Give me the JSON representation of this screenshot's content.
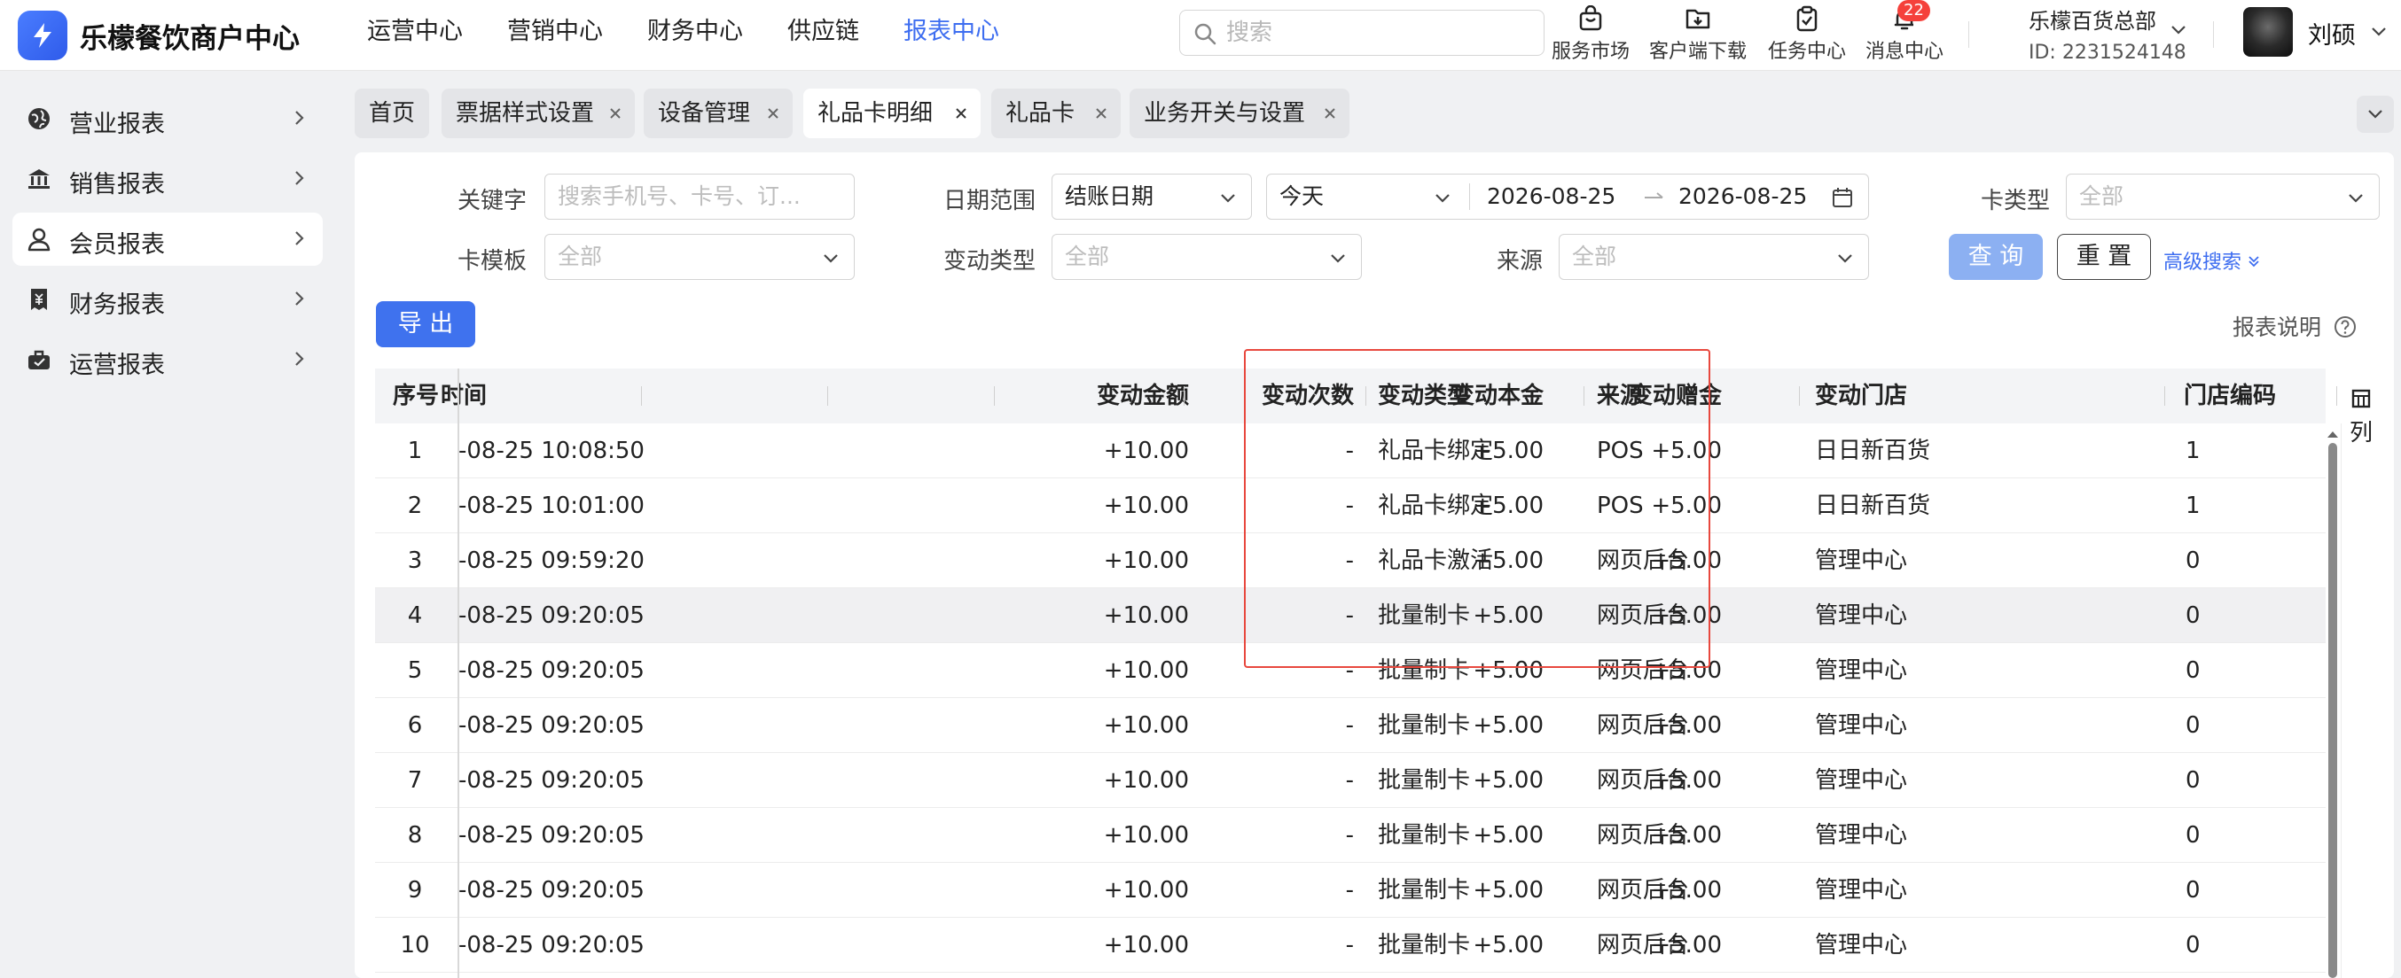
{
  "app": {
    "brand": "乐檬餐饮商户中心",
    "colors": {
      "primary": "#3f72ee",
      "active_nav": "#3d6df0",
      "highlight_box": "#e8483e",
      "badge": "#f5413b"
    }
  },
  "topnav": {
    "items": [
      {
        "label": "运营中心",
        "active": false
      },
      {
        "label": "营销中心",
        "active": false
      },
      {
        "label": "财务中心",
        "active": false
      },
      {
        "label": "供应链",
        "active": false
      },
      {
        "label": "报表中心",
        "active": true
      }
    ]
  },
  "search": {
    "placeholder": "搜索",
    "value": ""
  },
  "tools": {
    "service_market": "服务市场",
    "client_download": "客户端下载",
    "task_center": "任务中心",
    "message_center": "消息中心",
    "message_badge": "22"
  },
  "org": {
    "name": "乐檬百货总部",
    "id": "ID: 2231524148"
  },
  "user": {
    "name": "刘硕"
  },
  "sidebar": {
    "items": [
      {
        "label": "营业报表",
        "icon": "globe-icon"
      },
      {
        "label": "销售报表",
        "icon": "bank-icon"
      },
      {
        "label": "会员报表",
        "icon": "user-icon",
        "active": true
      },
      {
        "label": "财务报表",
        "icon": "receipt-icon"
      },
      {
        "label": "运营报表",
        "icon": "briefcase-icon"
      }
    ]
  },
  "tabs": [
    {
      "label": "首页",
      "closable": false
    },
    {
      "label": "票据样式设置",
      "closable": true
    },
    {
      "label": "设备管理",
      "closable": true
    },
    {
      "label": "礼品卡明细",
      "closable": true,
      "active": true
    },
    {
      "label": "礼品卡",
      "closable": true
    },
    {
      "label": "业务开关与设置",
      "closable": true
    }
  ],
  "filters": {
    "keyword": {
      "label": "关键字",
      "placeholder": "搜索手机号、卡号、订..."
    },
    "date_range": {
      "label": "日期范围",
      "type": "结账日期",
      "preset": "今天",
      "start": "2026-08-25",
      "end": "2026-08-25"
    },
    "card_type": {
      "label": "卡类型",
      "value": "全部"
    },
    "card_template": {
      "label": "卡模板",
      "value": "全部"
    },
    "change_type": {
      "label": "变动类型",
      "value": "全部"
    },
    "source": {
      "label": "来源",
      "value": "全部"
    },
    "query_button": "查 询",
    "reset_button": "重 置",
    "advanced_search": "高级搜索"
  },
  "export_button": "导 出",
  "report_help": "报表说明",
  "column_settings": "列",
  "table": {
    "columns": [
      "序号",
      "时间",
      "变动金额",
      "变动次数",
      "变动本金",
      "变动赠金",
      "变动类型",
      "来源",
      "变动门店",
      "门店编码"
    ],
    "rows": [
      [
        "1",
        "-08-25 10:08:50",
        "+10.00",
        "-",
        "+5.00",
        "+5.00",
        "礼品卡绑定",
        "POS",
        "日日新百货",
        "1"
      ],
      [
        "2",
        "-08-25 10:01:00",
        "+10.00",
        "-",
        "+5.00",
        "+5.00",
        "礼品卡绑定",
        "POS",
        "日日新百货",
        "1"
      ],
      [
        "3",
        "-08-25 09:59:20",
        "+10.00",
        "-",
        "+5.00",
        "+5.00",
        "礼品卡激活",
        "网页后台",
        "管理中心",
        "0"
      ],
      [
        "4",
        "-08-25 09:20:05",
        "+10.00",
        "-",
        "+5.00",
        "+5.00",
        "批量制卡",
        "网页后台",
        "管理中心",
        "0"
      ],
      [
        "5",
        "-08-25 09:20:05",
        "+10.00",
        "-",
        "+5.00",
        "+5.00",
        "批量制卡",
        "网页后台",
        "管理中心",
        "0"
      ],
      [
        "6",
        "-08-25 09:20:05",
        "+10.00",
        "-",
        "+5.00",
        "+5.00",
        "批量制卡",
        "网页后台",
        "管理中心",
        "0"
      ],
      [
        "7",
        "-08-25 09:20:05",
        "+10.00",
        "-",
        "+5.00",
        "+5.00",
        "批量制卡",
        "网页后台",
        "管理中心",
        "0"
      ],
      [
        "8",
        "-08-25 09:20:05",
        "+10.00",
        "-",
        "+5.00",
        "+5.00",
        "批量制卡",
        "网页后台",
        "管理中心",
        "0"
      ],
      [
        "9",
        "-08-25 09:20:05",
        "+10.00",
        "-",
        "+5.00",
        "+5.00",
        "批量制卡",
        "网页后台",
        "管理中心",
        "0"
      ],
      [
        "10",
        "-08-25 09:20:05",
        "+10.00",
        "-",
        "+5.00",
        "+5.00",
        "批量制卡",
        "网页后台",
        "管理中心",
        "0"
      ]
    ]
  }
}
